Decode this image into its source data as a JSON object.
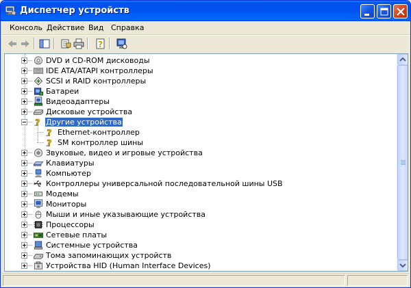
{
  "window": {
    "title": "Диспетчер устройств"
  },
  "menu": [
    "Консоль",
    "Действие",
    "Вид",
    "Справка"
  ],
  "toolbar": {
    "buttons": [
      "back-icon",
      "forward-icon",
      "show-hide-tree-icon",
      "properties-icon",
      "print-icon",
      "help-icon",
      "scan-hardware-icon"
    ]
  },
  "tree": {
    "items": [
      {
        "label": "DVD и CD-ROM дисководы",
        "icon": "cdrom-icon",
        "level": 0,
        "expanded": false
      },
      {
        "label": "IDE ATA/ATAPI контроллеры",
        "icon": "ide-controller-icon",
        "level": 0,
        "expanded": false
      },
      {
        "label": "SCSI и RAID контроллеры",
        "icon": "scsi-icon",
        "level": 0,
        "expanded": false
      },
      {
        "label": "Батареи",
        "icon": "battery-icon",
        "level": 0,
        "expanded": false
      },
      {
        "label": "Видеоадаптеры",
        "icon": "display-adapter-icon",
        "level": 0,
        "expanded": false
      },
      {
        "label": "Дисковые устройства",
        "icon": "disk-drive-icon",
        "level": 0,
        "expanded": false
      },
      {
        "label": "Другие устройства",
        "icon": "unknown-device-icon",
        "level": 0,
        "expanded": true,
        "selected": true
      },
      {
        "label": "Ethernet-контроллер",
        "icon": "unknown-device-icon",
        "level": 1
      },
      {
        "label": "SM контроллер шины",
        "icon": "unknown-device-icon",
        "level": 1
      },
      {
        "label": "Звуковые, видео и игровые устройства",
        "icon": "sound-icon",
        "level": 0,
        "expanded": false
      },
      {
        "label": "Клавиатуры",
        "icon": "keyboard-icon",
        "level": 0,
        "expanded": false
      },
      {
        "label": "Компьютер",
        "icon": "computer-icon",
        "level": 0,
        "expanded": false
      },
      {
        "label": "Контроллеры универсальной последовательной шины USB",
        "icon": "usb-icon",
        "level": 0,
        "expanded": false
      },
      {
        "label": "Модемы",
        "icon": "modem-icon",
        "level": 0,
        "expanded": false
      },
      {
        "label": "Мониторы",
        "icon": "monitor-icon",
        "level": 0,
        "expanded": false
      },
      {
        "label": "Мыши и иные указывающие устройства",
        "icon": "mouse-icon",
        "level": 0,
        "expanded": false
      },
      {
        "label": "Процессоры",
        "icon": "processor-icon",
        "level": 0,
        "expanded": false
      },
      {
        "label": "Сетевые платы",
        "icon": "network-adapter-icon",
        "level": 0,
        "expanded": false
      },
      {
        "label": "Системные устройства",
        "icon": "system-device-icon",
        "level": 0,
        "expanded": false
      },
      {
        "label": "Тома запоминающих устройств",
        "icon": "storage-volume-icon",
        "level": 0,
        "expanded": false
      },
      {
        "label": "Устройства HID (Human Interface Devices)",
        "icon": "hid-icon",
        "level": 0,
        "expanded": false
      }
    ]
  },
  "colors": {
    "titlebar": "#0053ee",
    "selection": "#316ac5",
    "window_bg": "#ece9d8"
  }
}
